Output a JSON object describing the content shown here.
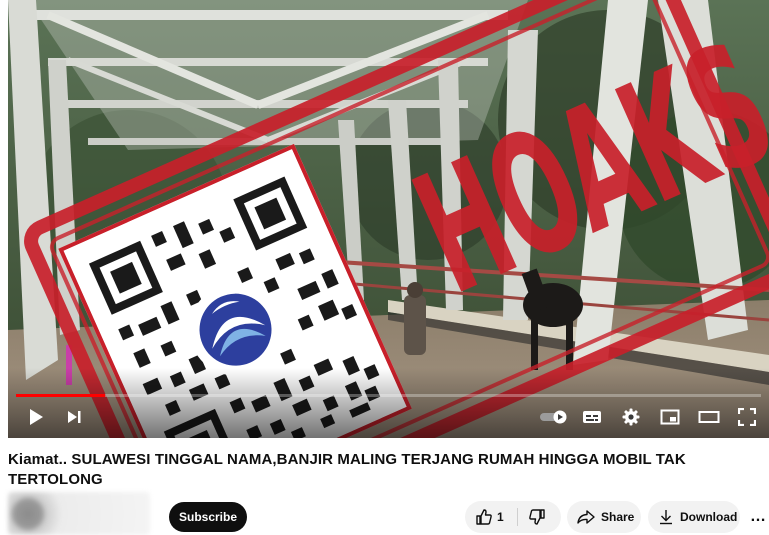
{
  "video": {
    "progress_fraction": 0.12,
    "overlay": {
      "stamp_text": "HOAKS",
      "stamp_color": "#c8202a"
    },
    "controls": {
      "play_icon": "play-icon",
      "next_icon": "next-icon",
      "autoplay_icon": "autoplay-toggle-icon",
      "captions_icon": "captions-icon",
      "settings_icon": "gear-icon",
      "miniplayer_icon": "miniplayer-icon",
      "theater_icon": "theater-mode-icon",
      "fullscreen_icon": "fullscreen-icon"
    }
  },
  "title": "Kiamat.. SULAWESI TINGGAL NAMA,BANJIR MALING TERJANG RUMAH HINGGA MOBIL TAK TERTOLONG",
  "actions": {
    "subscribe_label": "Subscribe",
    "like_count": "1",
    "share_label": "Share",
    "download_label": "Download",
    "more_label": "…"
  },
  "colors": {
    "brand_red": "#ff0000",
    "subscribe_bg": "#0f0f0f",
    "pill_bg": "#f2f2f2"
  }
}
